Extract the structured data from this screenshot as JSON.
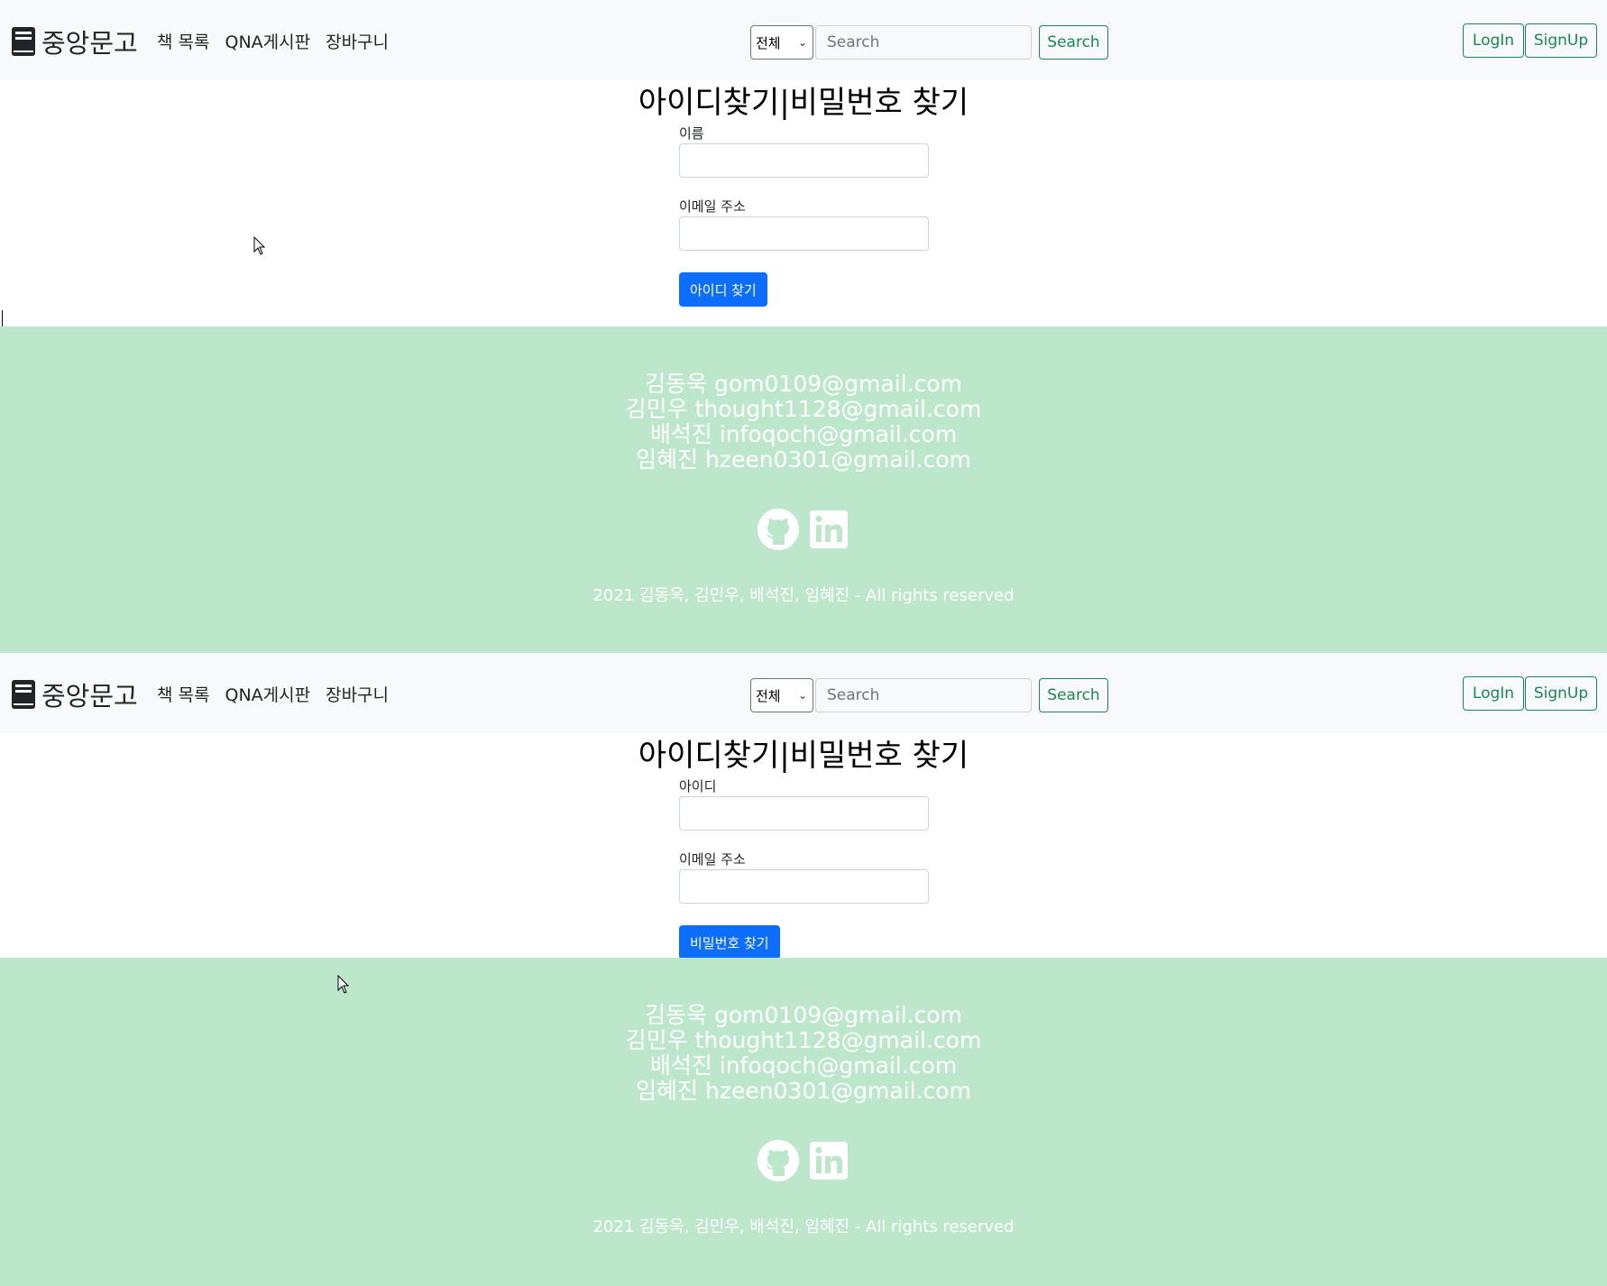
{
  "page1": {
    "navbar": {
      "brand": "중앙문고",
      "links": [
        "책 목록",
        "QNA게시판",
        "장바구니"
      ],
      "search_category": "전체",
      "search_placeholder": "Search",
      "search_button": "Search",
      "login": "LogIn",
      "signup": "SignUp"
    },
    "title": "아이디찾기|비밀번호 찾기",
    "form": {
      "field1_label": "이름",
      "field2_label": "이메일 주소",
      "submit": "아이디 찾기"
    },
    "footer": {
      "contacts": [
        "김동욱 gom0109@gmail.com",
        "김민우 thought1128@gmail.com",
        "배석진 infoqoch@gmail.com",
        "임혜진 hzeen0301@gmail.com"
      ],
      "copyright": "2021 김동욱, 김민우, 배석진, 임혜진 - All rights reserved"
    }
  },
  "page2": {
    "navbar": {
      "brand": "중앙문고",
      "links": [
        "책 목록",
        "QNA게시판",
        "장바구니"
      ],
      "search_category": "전체",
      "search_placeholder": "Search",
      "search_button": "Search",
      "login": "LogIn",
      "signup": "SignUp"
    },
    "title": "아이디찾기|비밀번호 찾기",
    "form": {
      "field1_label": "아이디",
      "field2_label": "이메일 주소",
      "submit": "비밀번호 찾기"
    },
    "footer": {
      "contacts": [
        "김동욱 gom0109@gmail.com",
        "김민우 thought1128@gmail.com",
        "배석진 infoqoch@gmail.com",
        "임혜진 hzeen0301@gmail.com"
      ],
      "copyright": "2021 김동욱, 김민우, 배석진, 임혜진 - All rights reserved"
    }
  },
  "icons": [
    "book-icon",
    "github-icon",
    "linkedin-icon",
    "chevron-down-icon",
    "mouse-cursor-icon"
  ],
  "colors": {
    "navbar_bg": "#f8f9fa",
    "footer_bg": "#bde7cb",
    "primary": "#0d6efd",
    "success": "#198754"
  }
}
